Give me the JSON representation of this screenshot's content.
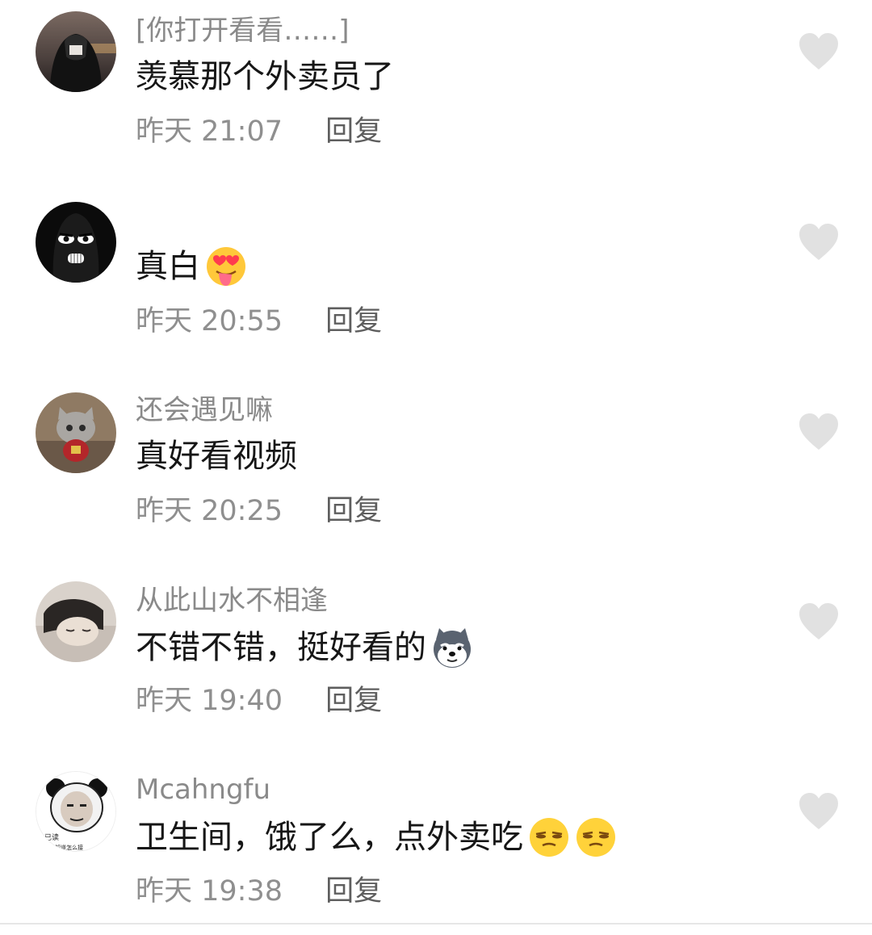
{
  "comments": [
    {
      "username": "",
      "quote": "[你打开看看……]",
      "text": "羡慕那个外卖员了",
      "time": "昨天 21:07",
      "reply": "回复",
      "avatar_icon": "hooded-person-avatar"
    },
    {
      "username": "",
      "text": "真白",
      "emoji": "heart-eyes-tongue-emoji",
      "time": "昨天 20:55",
      "reply": "回复",
      "avatar_icon": "black-balaclava-avatar"
    },
    {
      "username": "还会遇见嘛",
      "text": "真好看视频",
      "time": "昨天 20:25",
      "reply": "回复",
      "avatar_icon": "grey-cat-avatar"
    },
    {
      "username": "从此山水不相逢",
      "text": "不错不错，挺好看的",
      "emoji": "husky-dog-emoji",
      "time": "昨天 19:40",
      "reply": "回复",
      "avatar_icon": "sleeping-person-avatar"
    },
    {
      "username": "Mcahngfu",
      "text": "卫生间，饿了么，点外卖吃",
      "emoji": "smug-face-emoji",
      "time": "昨天 19:38",
      "reply": "回复",
      "avatar_icon": "panda-meme-avatar",
      "avatar_caption_1": "已读",
      "avatar_caption_2": "不知道怎么接"
    }
  ],
  "colors": {
    "username": "#8a8a8a",
    "text": "#161616",
    "meta": "#8f8f8f",
    "like_icon": "#e1e1e1"
  }
}
